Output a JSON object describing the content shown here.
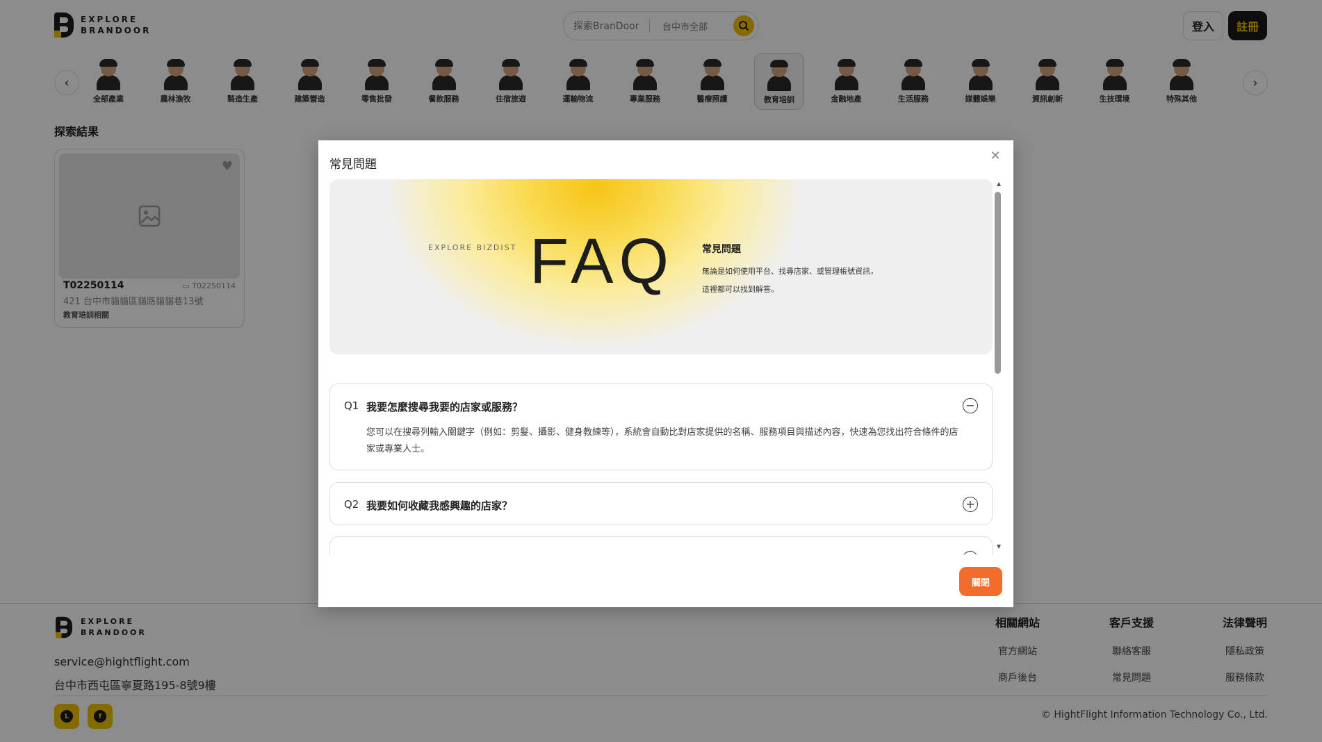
{
  "header": {
    "logo_line1": "EXPLORE",
    "logo_line2": "BRANDOOR",
    "search_placeholder": "探索BranDoor",
    "location": "台中市全部",
    "login_label": "登入",
    "signup_label": "註冊"
  },
  "categories": [
    "全部產業",
    "農林漁牧",
    "製造生產",
    "建築營造",
    "零售批發",
    "餐飲服務",
    "住宿旅遊",
    "運輸物流",
    "專業服務",
    "醫療照護",
    "教育培訓",
    "金融地產",
    "生活服務",
    "媒體娛樂",
    "資訊創新",
    "生技環境",
    "特殊其他"
  ],
  "active_category": "教育培訓",
  "results": {
    "title": "探索結果",
    "card": {
      "name": "T02250114",
      "id": "T02250114",
      "address": "421 台中市貓貓區貓路貓貓巷13號",
      "tag": "教育培訓相關"
    }
  },
  "modal": {
    "title": "常見問題",
    "banner_sub": "EXPLORE  BIZDIST",
    "banner_faq": "FAQ",
    "banner_heading": "常見問題",
    "banner_desc1": "無論是如何使用平台、找尋店家、或管理帳號資訊，",
    "banner_desc2": "這裡都可以找到解答。",
    "faqs": [
      {
        "num": "Q1",
        "question": "我要怎麼搜尋我要的店家或服務？",
        "answer": "您可以在搜尋列輸入關鍵字（例如：剪髮、攝影、健身教練等），系統會自動比對店家提供的名稱、服務項目與描述內容，快速為您找出符合條件的店家或專業人士。",
        "expanded": true
      },
      {
        "num": "Q2",
        "question": "我要如何收藏我感興趣的店家？",
        "expanded": false
      }
    ],
    "ok_label": "關閉"
  },
  "footer": {
    "logo_line1": "EXPLORE",
    "logo_line2": "BRANDOOR",
    "email": "service@hightflight.com",
    "address": "台中市西屯區寧夏路195-8號9樓",
    "columns": [
      {
        "heading": "相關網站",
        "links": [
          "官方網站",
          "商戶後台"
        ]
      },
      {
        "heading": "客戶支援",
        "links": [
          "聯絡客服",
          "常見問題"
        ]
      },
      {
        "heading": "法律聲明",
        "links": [
          "隱私政策",
          "服務條款"
        ]
      }
    ],
    "copyright": "© HightFlight Information Technology Co., Ltd."
  },
  "colors": {
    "brand_yellow": "#f2c200",
    "accent_orange": "#f26b2a",
    "dark": "#1a1a1a"
  }
}
